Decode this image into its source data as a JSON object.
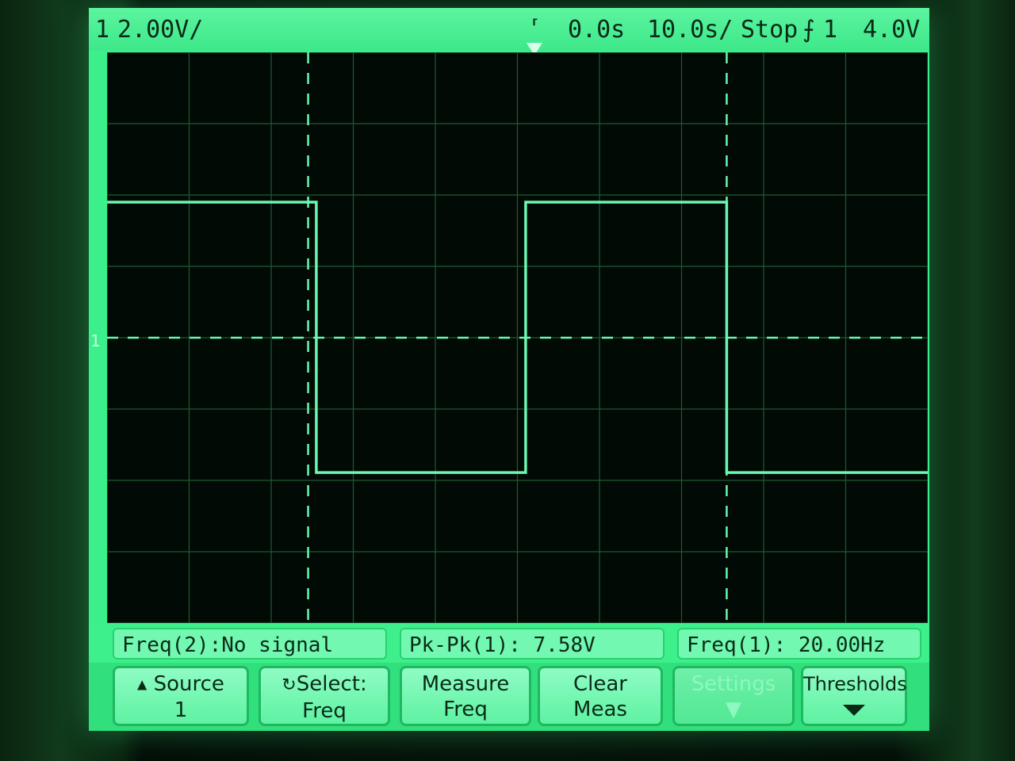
{
  "status": {
    "channel": "1",
    "volts_div": "2.00V/",
    "trigger_icon": "trigger-edge-icon",
    "delay": "0.0s",
    "time_div": "10.0s/",
    "run_state": "Stop",
    "trigger_source_icon": "rising-edge-icon",
    "trigger_channel": "1",
    "trigger_level": "4.0V"
  },
  "measurements": {
    "freq2": "Freq(2):No signal",
    "pkpk1": "Pk-Pk(1): 7.58V",
    "freq1": "Freq(1): 20.00Hz"
  },
  "softkeys": [
    {
      "icon": "up-triangle-icon",
      "line1": "Source",
      "line2": "1"
    },
    {
      "icon": "select-knob-icon",
      "line1": "Select:",
      "line2": "Freq"
    },
    {
      "line1": "Measure",
      "line2": "Freq"
    },
    {
      "line1": "Clear",
      "line2": "Meas"
    },
    {
      "line1": "Settings",
      "line2": ""
    },
    {
      "icon": "down-arrow-icon",
      "line1": "Thresholds",
      "line2": ""
    }
  ],
  "channel_marker": "1",
  "colors": {
    "phosphor": "#3bf08a",
    "trace": "#6af7b0",
    "background": "#010a04"
  },
  "chart_data": {
    "type": "line",
    "title": "",
    "xlabel": "",
    "ylabel": "",
    "grid": true,
    "x_divisions": 10,
    "y_divisions": 8,
    "xlim": [
      -50,
      50
    ],
    "ylim": [
      -8,
      8
    ],
    "series": [
      {
        "x": [
          -50,
          -24.5,
          -24.5,
          1,
          1,
          25.5,
          25.5,
          50
        ],
        "y": [
          3.8,
          3.8,
          -3.78,
          -3.78,
          3.8,
          3.8,
          -3.78,
          -3.78
        ]
      }
    ],
    "cursors_x": [
      -25.5,
      25.5
    ],
    "zero_level": 0
  }
}
